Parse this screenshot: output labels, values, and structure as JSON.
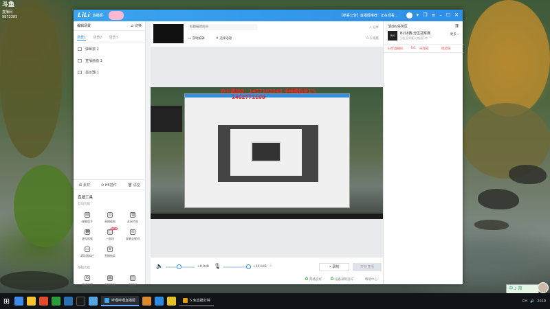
{
  "watermark": {
    "logo": "斗鱼",
    "sub1": "直播间",
    "room_id": "9873385"
  },
  "titlebar": {
    "app_logo": "LiLi",
    "app_name": "直播姬",
    "notice": "【恭喜公告】直播姬推荐：正在观看...",
    "icons": [
      "avatar-icon",
      "chevron-down-icon",
      "gift-icon",
      "menu-icon",
      "minimize-icon",
      "maximize-icon",
      "close-icon"
    ]
  },
  "left_panel": {
    "header": "编辑场景",
    "switch_label": "切换",
    "scene_tabs": [
      "场景1",
      "场景2",
      "场景3"
    ],
    "sources": [
      "弹幕窗 2",
      "直播画面 1",
      "显示器 1"
    ],
    "actions": {
      "material": "素材",
      "h5": "H5插件",
      "clear": "清空"
    },
    "tools_title": "直播工具",
    "section_interactive": "互动功能",
    "section_basic": "基础功能",
    "tools_row1": [
      "弹幕助手",
      "直播截图",
      "关闭特效"
    ],
    "tools_row2": [
      "虚拟形象",
      "一起玩",
      "屏蔽关键词"
    ],
    "tools_row3": [
      "滚动通知栏",
      "直播抽奖"
    ],
    "tools_basic": [
      "直播设置",
      "直播数据",
      "直播间"
    ],
    "new_badge": "NEW"
  },
  "center": {
    "room_title_placeholder": "标题描述房间",
    "category_label": "游戏编辑",
    "topic_label": "# 选择话题",
    "share_label": "分享",
    "stat_label": "0 人观看",
    "overlay_red_1": "办卡请加Q：1457103049  手续费低至1%",
    "overlay_red_2": "1462771100"
  },
  "controls": {
    "speaker_value": "+0.0dB",
    "mic_value": "+10.0dB",
    "record_label": "录制",
    "live_label": "开始直播",
    "status_items": [
      "网络良好",
      "设备录制良好",
      "帮助中心"
    ]
  },
  "right_panel": {
    "title": "活动&任务区",
    "promo_logo": "BLS",
    "promo_name": "BLS8赛·分区冠军赛",
    "promo_desc": "分区冠军赛火热进行中",
    "promo_more": "更多",
    "task_label": "分享直播间",
    "task_progress": "0/1",
    "task_status": "未完成",
    "task_reward": "经验值"
  },
  "ime": "中 ♪ 简",
  "taskbar": {
    "start_icon": "windows-icon",
    "items": [
      {
        "label": "哔哩哔哩直播姬",
        "color": "#3ba4f0",
        "active": true
      },
      {
        "label": "5.免直播分钟",
        "color": "#e5a000",
        "active": false
      }
    ],
    "tray_lang": "CH",
    "tray_time": "2019"
  }
}
